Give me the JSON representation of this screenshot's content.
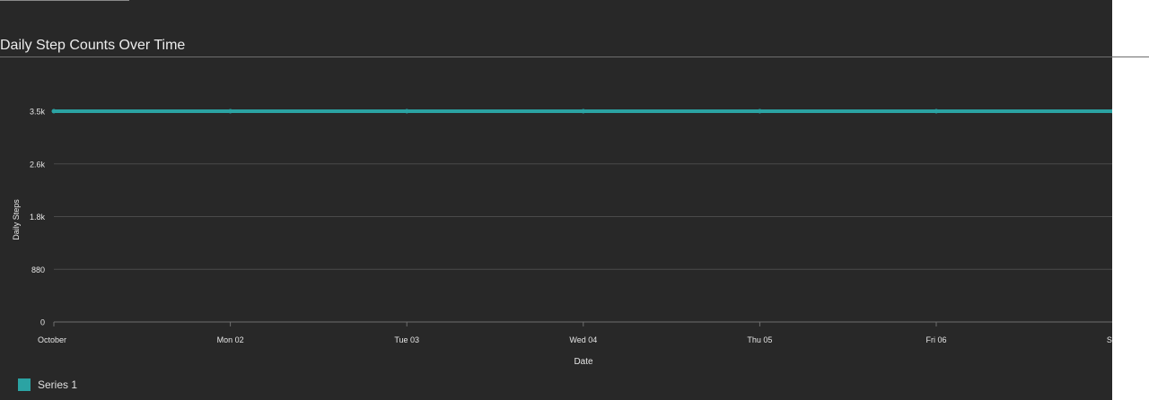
{
  "colors": {
    "background": "#282828",
    "gridline": "#4a4a4a",
    "axis": "#6e6e6e",
    "text": "#e6e6e6",
    "series": "#2ba3a3"
  },
  "chart_data": {
    "type": "line",
    "title": "Daily Step Counts Over Time",
    "xlabel": "Date",
    "ylabel": "Daily Steps",
    "x": [
      "October",
      "Mon 02",
      "Tue 03",
      "Wed 04",
      "Thu 05",
      "Fri 06",
      "Sat"
    ],
    "y_ticks": [
      "0",
      "880",
      "1.8k",
      "2.6k",
      "3.5k"
    ],
    "ylim": [
      0,
      3500
    ],
    "grid": true,
    "legend_position": "bottom-left",
    "series": [
      {
        "name": "Series 1",
        "values": [
          3500,
          3500,
          3500,
          3500,
          3500,
          3500,
          3500
        ]
      }
    ]
  }
}
